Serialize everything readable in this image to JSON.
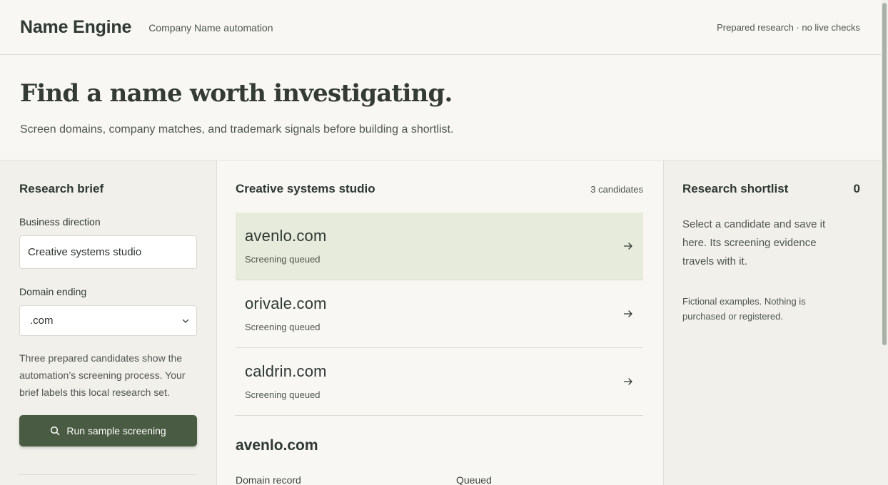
{
  "header": {
    "brand": "Name Engine",
    "subtitle": "Company Name automation",
    "note": "Prepared research · no live checks"
  },
  "hero": {
    "title": "Find a name worth investigating.",
    "subtitle": "Screen domains, company matches, and trademark signals before building a shortlist."
  },
  "brief": {
    "title": "Research brief",
    "direction_label": "Business direction",
    "direction_value": "Creative systems studio",
    "ending_label": "Domain ending",
    "ending_value": ".com",
    "help": "Three prepared candidates show the automation’s screening process. Your brief labels this local research set.",
    "run_label": "Run sample screening"
  },
  "results": {
    "title": "Creative systems studio",
    "count": "3 candidates",
    "candidates": [
      {
        "name": "avenlo.com",
        "status": "Screening queued"
      },
      {
        "name": "orivale.com",
        "status": "Screening queued"
      },
      {
        "name": "caldrin.com",
        "status": "Screening queued"
      }
    ],
    "detail": {
      "title": "avenlo.com",
      "row_label": "Domain record",
      "row_value": "Queued"
    }
  },
  "shortlist": {
    "title": "Research shortlist",
    "count": "0",
    "body": "Select a candidate and save it here. Its screening evidence travels with it.",
    "note": "Fictional examples. Nothing is purchased or registered."
  },
  "colors": {
    "accent": "#4a5b43",
    "selected_row": "#e7ebdb",
    "background": "#f8f7f3"
  },
  "icons": {
    "search": "search-icon",
    "arrow": "arrow-right-icon",
    "chevron": "chevron-down-icon"
  }
}
